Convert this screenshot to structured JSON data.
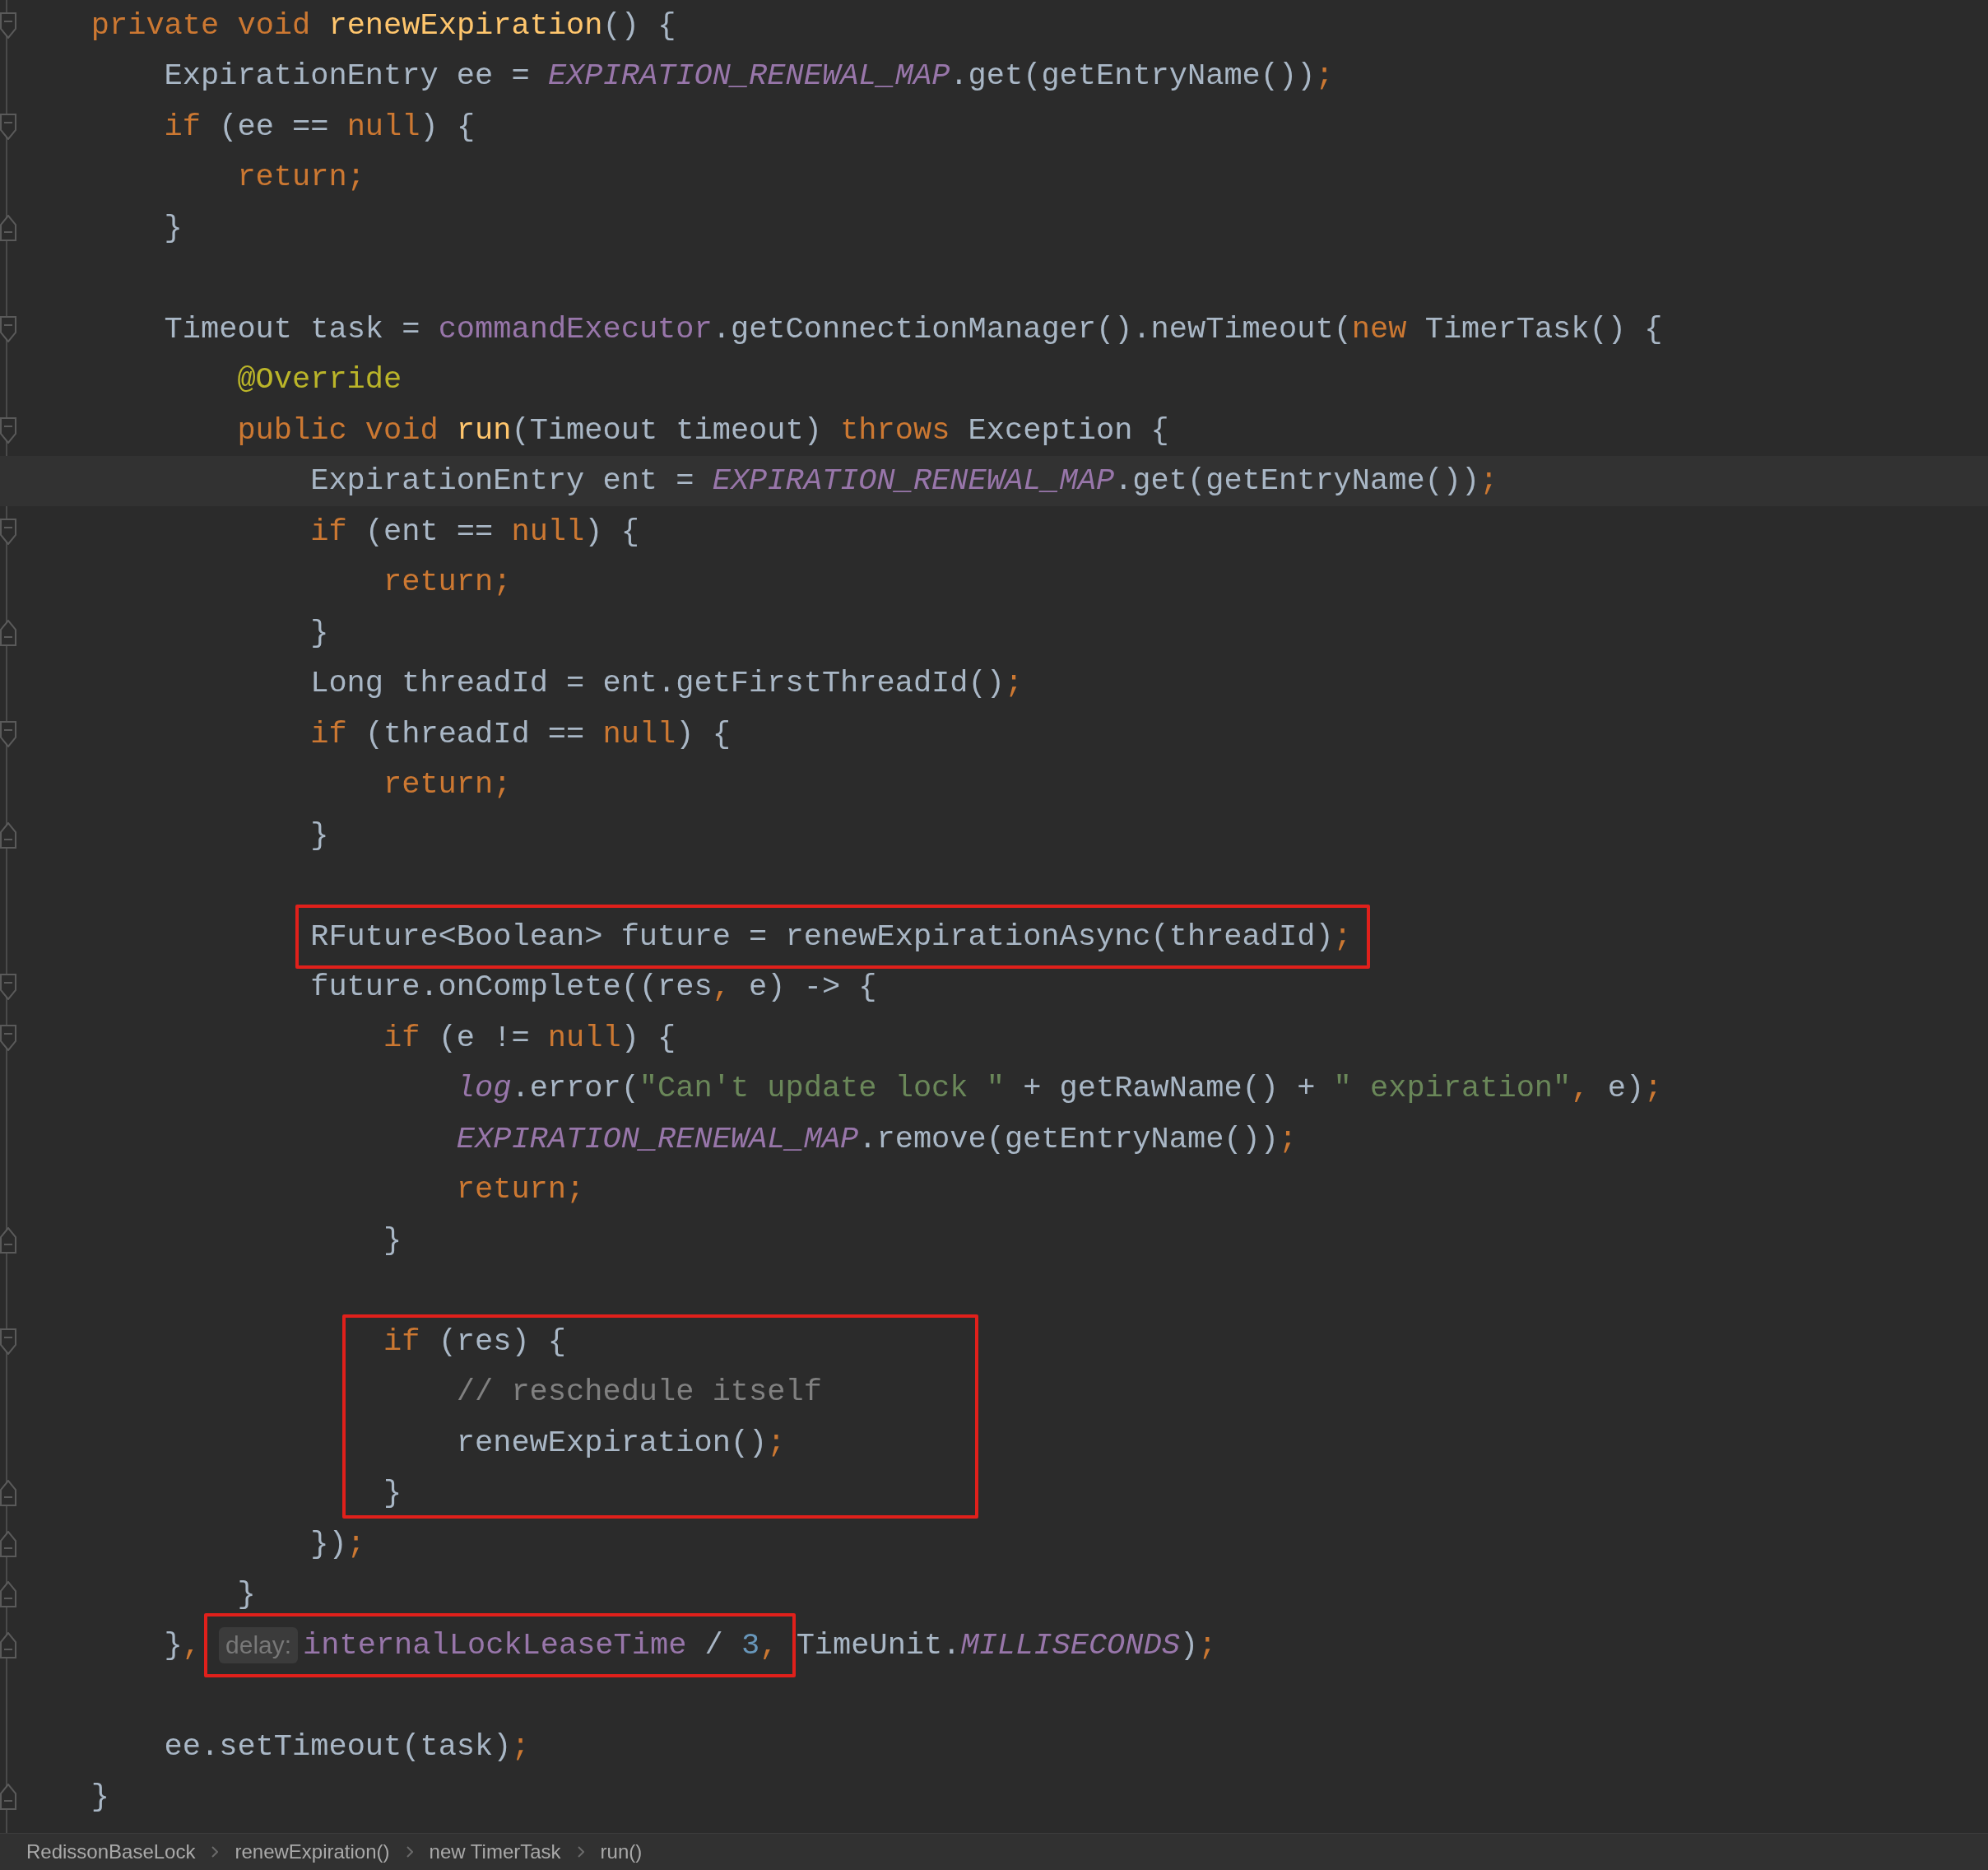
{
  "editor": {
    "lines": [
      {
        "kind": "code",
        "tokens": [
          {
            "text": "private void ",
            "kind": "keyword"
          },
          {
            "text": "renewExpiration",
            "kind": "declaration"
          },
          {
            "text": "() {",
            "kind": "plain"
          }
        ],
        "children": [
          {
            "kind": "code",
            "tokens": [
              {
                "text": "ExpirationEntry ee = ",
                "kind": "plain"
              },
              {
                "text": "EXPIRATION_RENEWAL_MAP",
                "kind": "constant"
              },
              {
                "text": ".get(getEntryName())",
                "kind": "plain"
              },
              {
                "text": ";",
                "kind": "punct"
              }
            ]
          },
          {
            "kind": "code",
            "tokens": [
              {
                "text": "if",
                "kind": "keyword"
              },
              {
                "text": " (ee == ",
                "kind": "plain"
              },
              {
                "text": "null",
                "kind": "keyword"
              },
              {
                "text": ") {",
                "kind": "plain"
              }
            ],
            "children": [
              {
                "kind": "code",
                "tokens": [
                  {
                    "text": "return;",
                    "kind": "keyword"
                  }
                ]
              }
            ]
          },
          {
            "kind": "close",
            "tokens": [
              {
                "text": "}",
                "kind": "plain"
              }
            ]
          },
          {
            "kind": "blank"
          },
          {
            "kind": "code",
            "tokens": [
              {
                "text": "Timeout task = ",
                "kind": "plain"
              },
              {
                "text": "commandExecutor",
                "kind": "field"
              },
              {
                "text": ".getConnectionManager().newTimeout(",
                "kind": "plain"
              },
              {
                "text": "new",
                "kind": "keyword"
              },
              {
                "text": " TimerTask() {",
                "kind": "plain"
              }
            ],
            "children": [
              {
                "kind": "code",
                "tokens": [
                  {
                    "text": "@Override",
                    "kind": "annotation"
                  }
                ]
              },
              {
                "kind": "code",
                "tokens": [
                  {
                    "text": "public void ",
                    "kind": "keyword"
                  },
                  {
                    "text": "run",
                    "kind": "declaration"
                  },
                  {
                    "text": "(Timeout timeout) ",
                    "kind": "plain"
                  },
                  {
                    "text": "throws",
                    "kind": "keyword"
                  },
                  {
                    "text": " Exception {",
                    "kind": "plain"
                  }
                ],
                "children": [
                  {
                    "kind": "code",
                    "highlighted": true,
                    "tokens": [
                      {
                        "text": "ExpirationEntry ent = ",
                        "kind": "plain"
                      },
                      {
                        "text": "EXPIRATION_RENEWAL_MAP",
                        "kind": "constant"
                      },
                      {
                        "text": ".get(getEntryName())",
                        "kind": "plain"
                      },
                      {
                        "text": ";",
                        "kind": "punct"
                      }
                    ]
                  },
                  {
                    "kind": "code",
                    "tokens": [
                      {
                        "text": "if",
                        "kind": "keyword"
                      },
                      {
                        "text": " (ent == ",
                        "kind": "plain"
                      },
                      {
                        "text": "null",
                        "kind": "keyword"
                      },
                      {
                        "text": ") {",
                        "kind": "plain"
                      }
                    ],
                    "children": [
                      {
                        "kind": "code",
                        "tokens": [
                          {
                            "text": "return;",
                            "kind": "keyword"
                          }
                        ]
                      }
                    ]
                  },
                  {
                    "kind": "close",
                    "tokens": [
                      {
                        "text": "}",
                        "kind": "plain"
                      }
                    ]
                  },
                  {
                    "kind": "code",
                    "tokens": [
                      {
                        "text": "Long threadId = ent.getFirstThreadId()",
                        "kind": "plain"
                      },
                      {
                        "text": ";",
                        "kind": "punct"
                      }
                    ]
                  },
                  {
                    "kind": "code",
                    "tokens": [
                      {
                        "text": "if",
                        "kind": "keyword"
                      },
                      {
                        "text": " (threadId == ",
                        "kind": "plain"
                      },
                      {
                        "text": "null",
                        "kind": "keyword"
                      },
                      {
                        "text": ") {",
                        "kind": "plain"
                      }
                    ],
                    "children": [
                      {
                        "kind": "code",
                        "tokens": [
                          {
                            "text": "return;",
                            "kind": "keyword"
                          }
                        ]
                      }
                    ]
                  },
                  {
                    "kind": "close",
                    "tokens": [
                      {
                        "text": "}",
                        "kind": "plain"
                      }
                    ]
                  },
                  {
                    "kind": "blank"
                  },
                  {
                    "kind": "code",
                    "tokens": [
                      {
                        "text": "RFuture<Boolean> future = renewExpirationAsync(threadId)",
                        "kind": "plain",
                        "boxed": true
                      },
                      {
                        "text": ";",
                        "kind": "punct",
                        "boxed": true
                      }
                    ]
                  },
                  {
                    "kind": "code",
                    "tokens": [
                      {
                        "text": "future.onComplete((res",
                        "kind": "plain"
                      },
                      {
                        "text": ",",
                        "kind": "punct"
                      },
                      {
                        "text": " e) -> {",
                        "kind": "plain"
                      }
                    ],
                    "children": [
                      {
                        "kind": "code",
                        "tokens": [
                          {
                            "text": "if",
                            "kind": "keyword"
                          },
                          {
                            "text": " (e != ",
                            "kind": "plain"
                          },
                          {
                            "text": "null",
                            "kind": "keyword"
                          },
                          {
                            "text": ") {",
                            "kind": "plain"
                          }
                        ],
                        "children": [
                          {
                            "kind": "code",
                            "tokens": [
                              {
                                "text": "log",
                                "kind": "constant"
                              },
                              {
                                "text": ".error(",
                                "kind": "plain"
                              },
                              {
                                "text": "\"Can't update lock \"",
                                "kind": "string"
                              },
                              {
                                "text": " + getRawName() + ",
                                "kind": "plain"
                              },
                              {
                                "text": "\" expiration\"",
                                "kind": "string"
                              },
                              {
                                "text": ",",
                                "kind": "punct"
                              },
                              {
                                "text": " e)",
                                "kind": "plain"
                              },
                              {
                                "text": ";",
                                "kind": "punct"
                              }
                            ]
                          },
                          {
                            "kind": "code",
                            "tokens": [
                              {
                                "text": "EXPIRATION_RENEWAL_MAP",
                                "kind": "constant"
                              },
                              {
                                "text": ".remove(getEntryName())",
                                "kind": "plain"
                              },
                              {
                                "text": ";",
                                "kind": "punct"
                              }
                            ]
                          },
                          {
                            "kind": "code",
                            "tokens": [
                              {
                                "text": "return;",
                                "kind": "keyword"
                              }
                            ]
                          }
                        ]
                      },
                      {
                        "kind": "close",
                        "tokens": [
                          {
                            "text": "}",
                            "kind": "plain"
                          }
                        ]
                      },
                      {
                        "kind": "blank"
                      },
                      {
                        "kind": "code",
                        "tokens": [
                          {
                            "text": "if",
                            "kind": "keyword",
                            "boxed": true
                          },
                          {
                            "text": " (res) {",
                            "kind": "plain",
                            "boxed": true
                          }
                        ],
                        "children": [
                          {
                            "kind": "code",
                            "tokens": [
                              {
                                "text": "// reschedule itself",
                                "kind": "comment",
                                "boxed": true
                              }
                            ]
                          },
                          {
                            "kind": "code",
                            "tokens": [
                              {
                                "text": "renewExpiration()",
                                "kind": "plain",
                                "boxed": true
                              },
                              {
                                "text": ";",
                                "kind": "punct",
                                "boxed": true
                              }
                            ]
                          }
                        ]
                      },
                      {
                        "kind": "close",
                        "tokens": [
                          {
                            "text": "}",
                            "kind": "plain",
                            "boxed": true
                          }
                        ]
                      }
                    ]
                  },
                  {
                    "kind": "close",
                    "tokens": [
                      {
                        "text": "})",
                        "kind": "plain"
                      },
                      {
                        "text": ";",
                        "kind": "punct"
                      }
                    ]
                  }
                ]
              },
              {
                "kind": "close",
                "tokens": [
                  {
                    "text": "}",
                    "kind": "plain"
                  }
                ]
              }
            ]
          },
          {
            "kind": "close",
            "tokens": [
              {
                "text": "}",
                "kind": "plain"
              },
              {
                "text": ",",
                "kind": "punct"
              },
              {
                "text": "delay:",
                "kind": "hint",
                "boxed": true
              },
              {
                "text": "internalLockLeaseTime",
                "kind": "field",
                "boxed": true
              },
              {
                "text": " / ",
                "kind": "plain",
                "boxed": true
              },
              {
                "text": "3",
                "kind": "number",
                "boxed": true
              },
              {
                "text": ",",
                "kind": "punct",
                "boxed": true
              },
              {
                "text": " TimeUnit.",
                "kind": "plain"
              },
              {
                "text": "MILLISECONDS",
                "kind": "constant"
              },
              {
                "text": ")",
                "kind": "plain"
              },
              {
                "text": ";",
                "kind": "punct"
              }
            ]
          },
          {
            "kind": "blank"
          },
          {
            "kind": "code",
            "tokens": [
              {
                "text": "ee.setTimeout(task)",
                "kind": "plain"
              },
              {
                "text": ";",
                "kind": "punct"
              }
            ]
          }
        ]
      },
      {
        "kind": "close",
        "tokens": [
          {
            "text": "}",
            "kind": "plain"
          }
        ]
      }
    ]
  },
  "breadcrumbs": [
    "RedissonBaseLock",
    "renewExpiration()",
    "new TimerTask",
    "run()"
  ]
}
